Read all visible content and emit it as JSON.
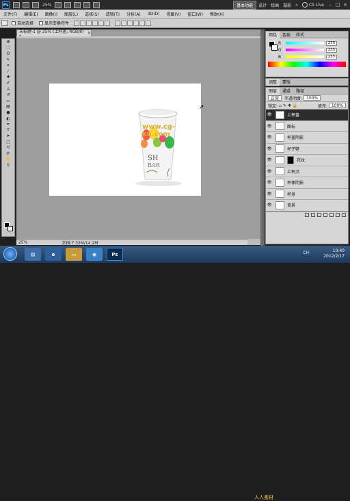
{
  "topbar": {
    "logo": "Ps",
    "zoom": "25%",
    "workspace": "基本功能",
    "workspace_items": [
      "设计",
      "绘画",
      "摄影",
      "»"
    ],
    "cslive": "CS Live",
    "controls": [
      "–",
      "□",
      "×"
    ]
  },
  "menu": [
    "文件(F)",
    "编辑(E)",
    "图像(I)",
    "图层(L)",
    "选择(S)",
    "滤镜(T)",
    "分析(A)",
    "3D(D)",
    "视图(V)",
    "窗口(W)",
    "帮助(H)"
  ],
  "options": {
    "auto_select": "自动选择",
    "show_transform": "显示变换控件"
  },
  "document": {
    "tab_title": "未标题-1 @ 25% (上杯盖, RGB/8) *",
    "tab_close": "×",
    "zoom": "25%",
    "file_size": "文档:7.32M/14.2M",
    "watermark": "www.cg-ku.com"
  },
  "color_panel": {
    "tabs": [
      "颜色",
      "色板",
      "样式"
    ],
    "channels": [
      {
        "label": "R",
        "value": "255",
        "color": "#f06060"
      },
      {
        "label": "G",
        "value": "255",
        "color": "#60d060"
      },
      {
        "label": "B",
        "value": "255",
        "color": "#6060f0"
      }
    ]
  },
  "adjust_panel": {
    "tabs": [
      "调整",
      "蒙版"
    ]
  },
  "layers_panel": {
    "tabs": [
      "图层",
      "通道",
      "路径"
    ],
    "blend_mode": "正常",
    "opacity_label": "不透明度:",
    "opacity": "100%",
    "lock_label": "锁定:",
    "fill_label": "填充:",
    "fill": "100%",
    "layers": [
      {
        "name": "上杯盖",
        "selected": true,
        "mask": false
      },
      {
        "name": "图标",
        "selected": false,
        "mask": false
      },
      {
        "name": "杯盖阴影",
        "selected": false,
        "mask": false
      },
      {
        "name": "杯子壁",
        "selected": false,
        "mask": false
      },
      {
        "name": "花纹",
        "selected": false,
        "mask": true
      },
      {
        "name": "上杯沿",
        "selected": false,
        "mask": false
      },
      {
        "name": "杯体阴影",
        "selected": false,
        "mask": false
      },
      {
        "name": "杯身",
        "selected": false,
        "mask": false
      },
      {
        "name": "背景",
        "selected": false,
        "mask": false
      }
    ]
  },
  "taskbar": {
    "time": "10:40",
    "date": "2012/2/17",
    "tray": "CH",
    "watermark": "人人素材"
  },
  "colors": {
    "accent": "#2c2c2c",
    "taskbar": "#1d3a5c"
  }
}
